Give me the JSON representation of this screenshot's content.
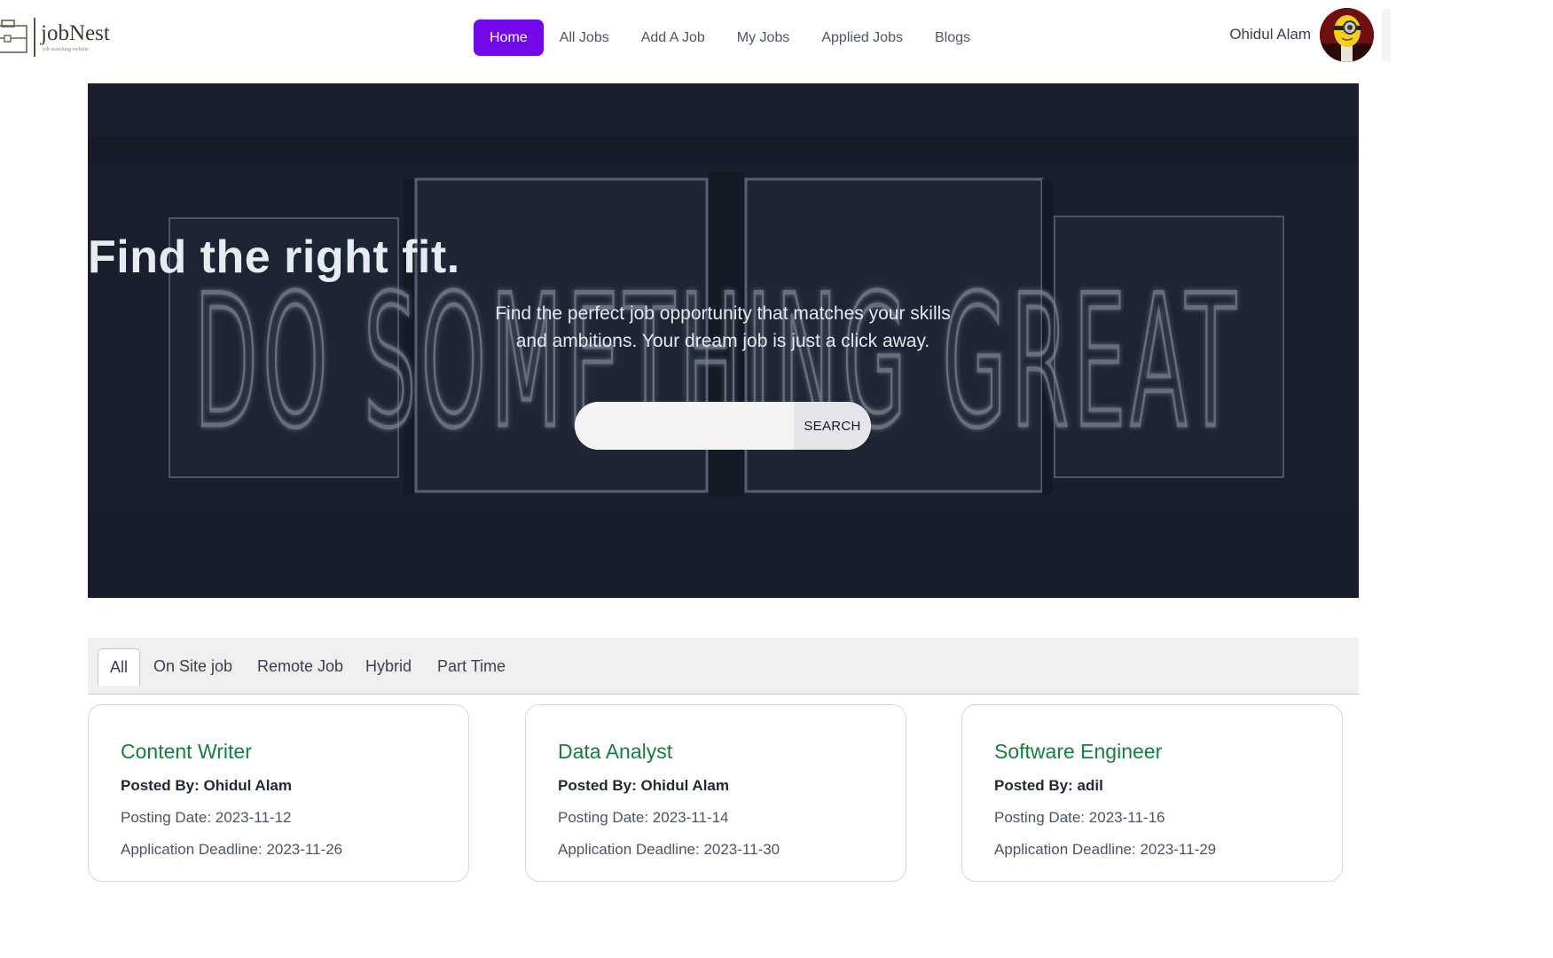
{
  "brand": {
    "name": "jobNest",
    "tagline": "job searching website"
  },
  "nav": {
    "links": [
      {
        "label": "Home",
        "active": true
      },
      {
        "label": "All Jobs",
        "active": false
      },
      {
        "label": "Add A Job",
        "active": false
      },
      {
        "label": "My Jobs",
        "active": false
      },
      {
        "label": "Applied Jobs",
        "active": false
      },
      {
        "label": "Blogs",
        "active": false
      }
    ],
    "active_color": "#7309e8"
  },
  "user": {
    "name": "Ohidul Alam"
  },
  "hero": {
    "title": "Find the right fit.",
    "subtitle": "Find the perfect job opportunity that matches your skills and ambitions. Your dream job is just a click away.",
    "background_text": "DO SOMETHING GREAT",
    "search": {
      "value": "",
      "placeholder": "",
      "button_label": "SEARCH"
    }
  },
  "tabs": [
    {
      "label": "All",
      "active": true
    },
    {
      "label": "On Site job",
      "active": false
    },
    {
      "label": "Remote Job",
      "active": false
    },
    {
      "label": "Hybrid",
      "active": false
    },
    {
      "label": "Part Time",
      "active": false
    }
  ],
  "jobs": [
    {
      "title": "Content Writer",
      "posted_by": "Posted By: Ohidul Alam",
      "posting_date": "Posting Date: 2023-11-12",
      "deadline": "Application Deadline: 2023-11-26"
    },
    {
      "title": "Data Analyst",
      "posted_by": "Posted By: Ohidul Alam",
      "posting_date": "Posting Date: 2023-11-14",
      "deadline": "Application Deadline: 2023-11-30"
    },
    {
      "title": "Software Engineer",
      "posted_by": "Posted By: adil",
      "posting_date": "Posting Date: 2023-11-16",
      "deadline": "Application Deadline: 2023-11-29"
    }
  ],
  "colors": {
    "accent": "#7309e8",
    "job_title": "#15803d"
  }
}
